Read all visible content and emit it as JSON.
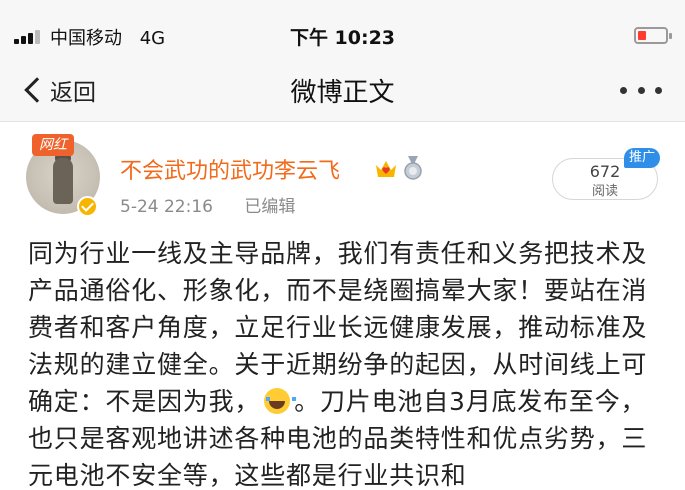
{
  "status_bar": {
    "carrier": "中国移动",
    "network": "4G",
    "time": "下午 10:23",
    "battery_color": "#ff3b30"
  },
  "nav": {
    "back_label": "返回",
    "title": "微博正文",
    "more_icon": "more-dots-icon"
  },
  "post": {
    "badge": "网红",
    "username": "不会武功的武功李云飞",
    "username_color": "#f26a1b",
    "date": "5-24 22:16",
    "edited": "已编辑",
    "read_count": "672",
    "read_label": "阅读",
    "promo": "推广",
    "body_part1": "同为行业一线及主导品牌，我们有责任和义务把技术及产品通俗化、形象化，而不是绕圈搞晕大家！要站在消费者和客户角度，立足行业长远健康发展，推动标准及法规的建立健全。关于近期纷争的起因，从时间线上可确定：不是因为我，",
    "emoji": "laugh-cry-emoji",
    "body_part2": "。刀片电池自3月底发布至今，也只是客观地讲述各种电池的品类特性和优点劣势，三元电池不安全等，这些都是行业共识和"
  }
}
